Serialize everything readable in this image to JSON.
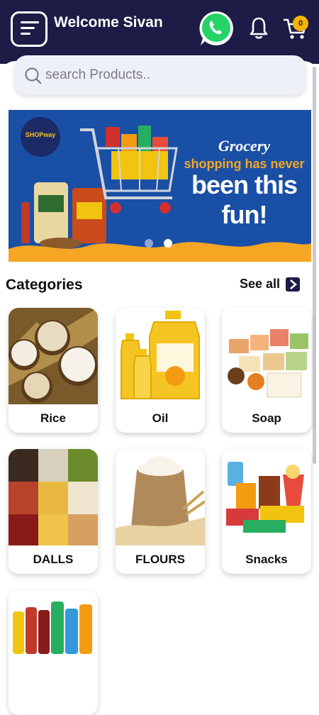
{
  "header": {
    "welcome": "Welcome Sivan",
    "cart_count": "0"
  },
  "search": {
    "placeholder": "search Products.."
  },
  "banner": {
    "logo_text": "SHOPway",
    "line1": "Grocery",
    "line2": "shopping has never",
    "line3": "been this fun!",
    "slides": 2,
    "active_slide": 2
  },
  "categories": {
    "title": "Categories",
    "see_all": "See all",
    "items": [
      {
        "label": "Rice"
      },
      {
        "label": "Oil"
      },
      {
        "label": "Soap"
      },
      {
        "label": "DALLS"
      },
      {
        "label": "FLOURS"
      },
      {
        "label": "Snacks"
      },
      {
        "label": ""
      }
    ]
  },
  "colors": {
    "header_bg": "#1d1c46",
    "banner_bg": "#1a4fa6",
    "banner_accent": "#f5a623",
    "badge": "#f5b400",
    "whatsapp": "#25d366"
  },
  "icons": [
    "menu-icon",
    "whatsapp-icon",
    "bell-icon",
    "cart-icon",
    "search-icon",
    "chevron-right-icon"
  ]
}
